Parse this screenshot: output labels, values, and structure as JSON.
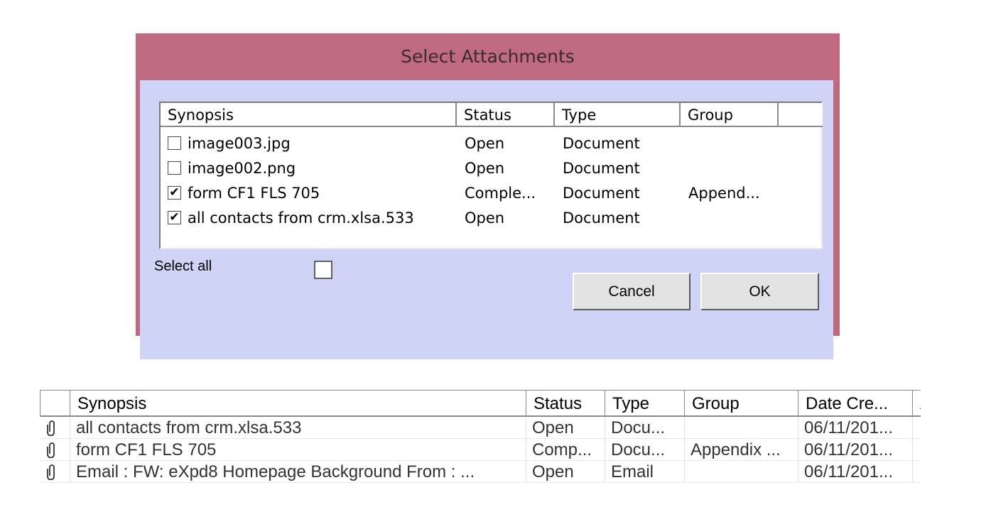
{
  "dialog": {
    "title": "Select Attachments",
    "columns": [
      "Synopsis",
      "Status",
      "Type",
      "Group",
      ""
    ],
    "rows": [
      {
        "checked": false,
        "synopsis": "image003.jpg",
        "status": "Open",
        "type": "Document",
        "group": ""
      },
      {
        "checked": false,
        "synopsis": "image002.png",
        "status": "Open",
        "type": "Document",
        "group": ""
      },
      {
        "checked": true,
        "synopsis": "form CF1 FLS 705",
        "status": "Comple...",
        "type": "Document",
        "group": "Append..."
      },
      {
        "checked": true,
        "synopsis": "all contacts from crm.xlsa.533",
        "status": "Open",
        "type": "Document",
        "group": ""
      }
    ],
    "select_all_label": "Select all",
    "select_all_checked": false,
    "cancel_label": "Cancel",
    "ok_label": "OK"
  },
  "grid": {
    "columns": [
      "",
      "Synopsis",
      "Status",
      "Type",
      "Group",
      "Date Cre...",
      "Al"
    ],
    "rows": [
      {
        "icon": "paperclip-icon",
        "synopsis": "all contacts from crm.xlsa.533",
        "status": "Open",
        "type": "Docu...",
        "group": "",
        "date": "06/11/201..."
      },
      {
        "icon": "paperclip-icon",
        "synopsis": "form CF1 FLS 705",
        "status": "Comp...",
        "type": "Docu...",
        "group": "Appendix ...",
        "date": "06/11/201..."
      },
      {
        "icon": "paperclip-icon",
        "synopsis": "Email : FW: eXpd8 Homepage Background From : ...",
        "status": "Open",
        "type": "Email",
        "group": "",
        "date": "06/11/201..."
      }
    ]
  }
}
